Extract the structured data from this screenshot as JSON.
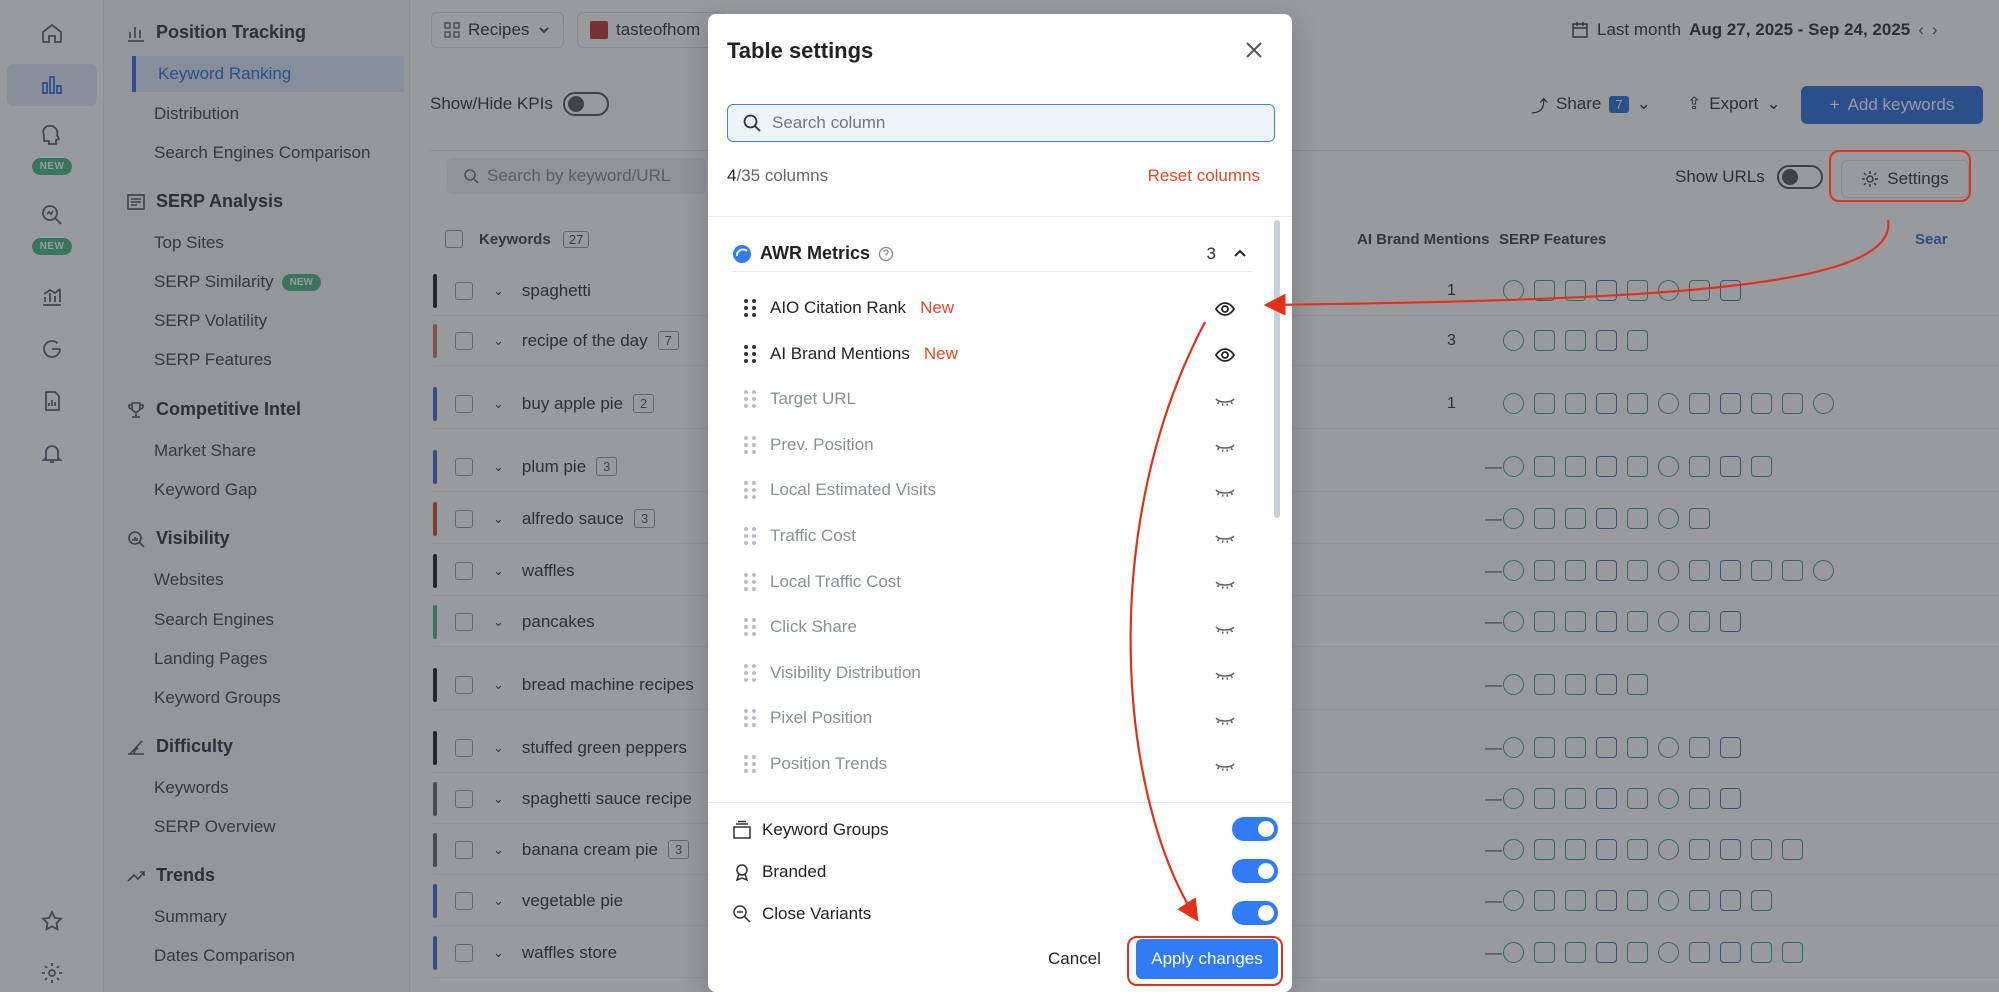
{
  "rail": {
    "new_badge_1": "NEW",
    "new_badge_2": "NEW"
  },
  "nav": {
    "sections": [
      {
        "title": "Position Tracking",
        "items": [
          "Keyword Ranking",
          "Distribution",
          "Search Engines Comparison"
        ]
      },
      {
        "title": "SERP Analysis",
        "items": [
          "Top Sites",
          "SERP Similarity",
          "SERP Volatility",
          "SERP Features"
        ]
      },
      {
        "title": "Competitive Intel",
        "items": [
          "Market Share",
          "Keyword Gap"
        ]
      },
      {
        "title": "Visibility",
        "items": [
          "Websites",
          "Search Engines",
          "Landing Pages",
          "Keyword Groups"
        ]
      },
      {
        "title": "Difficulty",
        "items": [
          "Keywords",
          "SERP Overview"
        ]
      },
      {
        "title": "Trends",
        "items": [
          "Summary",
          "Dates Comparison"
        ]
      }
    ],
    "serp_similarity_badge": "NEW"
  },
  "topbar": {
    "recipes": "Recipes",
    "site": "tasteofhom",
    "date_label": "Last month",
    "date_range": "Aug 27, 2025 - Sep 24, 2025",
    "share": "Share",
    "share_count": "7",
    "export": "Export",
    "add_keywords": "Add keywords"
  },
  "toolbar": {
    "show_hide_kpis": "Show/Hide KPIs",
    "search_placeholder": "Search by keyword/URL",
    "show_urls": "Show URLs",
    "settings": "Settings"
  },
  "table": {
    "headers": {
      "keywords": "Keywords",
      "keywords_count": "27",
      "ai_brand_mentions": "AI Brand Mentions",
      "serp_features": "SERP Features",
      "search": "Sear"
    },
    "rows": [
      {
        "kw": "spaghetti",
        "count": "",
        "val": "1"
      },
      {
        "kw": "recipe of the day",
        "count": "7",
        "val": "3"
      },
      {
        "kw": "buy apple pie",
        "count": "2",
        "val": "1"
      },
      {
        "kw": "plum pie",
        "count": "3",
        "val": "—"
      },
      {
        "kw": "alfredo sauce",
        "count": "3",
        "val": "—"
      },
      {
        "kw": "waffles",
        "count": "",
        "val": "—"
      },
      {
        "kw": "pancakes",
        "count": "",
        "val": "—"
      },
      {
        "kw": "bread machine recipes",
        "count": "",
        "val": "—"
      },
      {
        "kw": "stuffed green peppers",
        "count": "",
        "val": "—"
      },
      {
        "kw": "spaghetti sauce recipe",
        "count": "",
        "val": "—"
      },
      {
        "kw": "banana cream pie",
        "count": "3",
        "val": "—"
      },
      {
        "kw": "vegetable pie",
        "count": "",
        "val": "—"
      },
      {
        "kw": "waffles store",
        "count": "",
        "val": "—"
      }
    ]
  },
  "modal": {
    "title": "Table settings",
    "search_placeholder": "Search column",
    "count_shown": "4",
    "count_total": "/35 columns",
    "reset": "Reset columns",
    "group_name": "AWR Metrics",
    "group_count": "3",
    "columns": [
      {
        "label": "AIO Citation Rank",
        "tag": "New",
        "visible": true
      },
      {
        "label": "AI Brand Mentions",
        "tag": "New",
        "visible": true
      },
      {
        "label": "Target URL",
        "tag": "",
        "visible": false
      },
      {
        "label": "Prev. Position",
        "tag": "",
        "visible": false
      },
      {
        "label": "Local Estimated Visits",
        "tag": "",
        "visible": false
      },
      {
        "label": "Traffic Cost",
        "tag": "",
        "visible": false
      },
      {
        "label": "Local Traffic Cost",
        "tag": "",
        "visible": false
      },
      {
        "label": "Click Share",
        "tag": "",
        "visible": false
      },
      {
        "label": "Visibility Distribution",
        "tag": "",
        "visible": false
      },
      {
        "label": "Pixel Position",
        "tag": "",
        "visible": false
      },
      {
        "label": "Position Trends",
        "tag": "",
        "visible": false
      }
    ],
    "toggles": [
      {
        "label": "Keyword Groups",
        "on": true
      },
      {
        "label": "Branded",
        "on": true
      },
      {
        "label": "Close Variants",
        "on": true
      }
    ],
    "cancel": "Cancel",
    "apply": "Apply changes"
  },
  "colors": {
    "accent": "#2f6fd8",
    "highlight": "#e3301a",
    "new_tag": "#e04b2a",
    "serp_green": "#37a67a"
  }
}
